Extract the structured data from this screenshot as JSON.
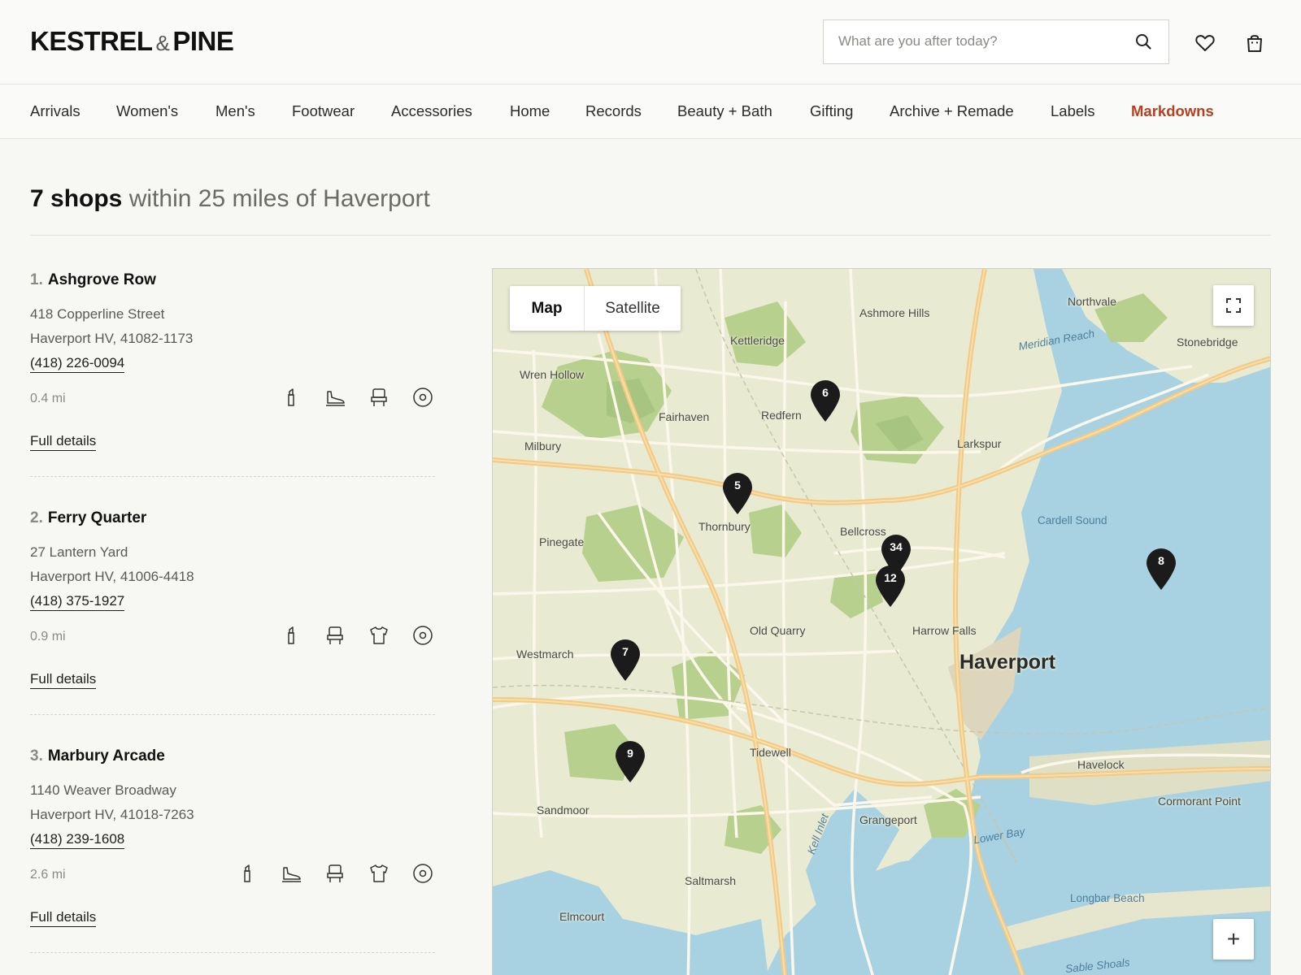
{
  "brand": {
    "name_left": "KESTREL",
    "amp": "&",
    "name_right": "PINE"
  },
  "search": {
    "placeholder": "What are you after today?"
  },
  "header_icons": [
    "search-icon",
    "heart-icon",
    "bag-icon"
  ],
  "nav": {
    "items": [
      "Arrivals",
      "Women's",
      "Men's",
      "Footwear",
      "Accessories",
      "Home",
      "Records",
      "Beauty + Bath",
      "Gifting",
      "Archive + Remade",
      "Labels"
    ],
    "sale": "Markdowns",
    "sale_color": "#b8401f"
  },
  "results": {
    "count": "7 shops",
    "rest": "within 25 miles of Haverport"
  },
  "shops": [
    {
      "num": "1.",
      "name": "Ashgrove Row",
      "street": "418 Copperline Street",
      "city": "Haverport HV, 41082-1173",
      "phone": "(418) 226-0094",
      "distance": "0.4 mi",
      "icons": [
        "lipstick-icon",
        "shoe-icon",
        "chair-icon",
        "record-icon"
      ],
      "details": "Full details"
    },
    {
      "num": "2.",
      "name": "Ferry Quarter",
      "street": "27 Lantern Yard",
      "city": "Haverport HV, 41006-4418",
      "phone": "(418) 375-1927",
      "distance": "0.9 mi",
      "icons": [
        "lipstick-icon",
        "chair-icon",
        "shirt-icon",
        "record-icon"
      ],
      "details": "Full details"
    },
    {
      "num": "3.",
      "name": "Marbury Arcade",
      "street": "1140 Weaver Broadway",
      "city": "Haverport HV, 41018-7263",
      "phone": "(418) 239-1608",
      "distance": "2.6 mi",
      "icons": [
        "lipstick-icon",
        "shoe-icon",
        "chair-icon",
        "shirt-icon",
        "record-icon"
      ],
      "details": "Full details"
    }
  ],
  "map": {
    "mode_map": "Map",
    "mode_satellite": "Satellite",
    "active_mode": "Map",
    "zoom_in": "+",
    "colors": {
      "water": "#a8d2e2",
      "land": "#e8ead2",
      "park": "#b8d08e",
      "road_major": "#f2c987",
      "road_minor": "#fbf7ea"
    },
    "places": [
      "Ashmore Hills",
      "Northvale",
      "Stonebridge",
      "Kettleridge",
      "Wren Hollow",
      "Redfern",
      "Fairhaven",
      "Milbury",
      "Larkspur",
      "Thornbury",
      "Pinegate",
      "Bellcross",
      "Cardell Sound",
      "Harrow Falls",
      "Old Quarry",
      "Westmarch",
      "Haverport",
      "Tidewell",
      "Havelock",
      "Sandmoor",
      "Grangeport",
      "Cormorant Point",
      "Saltmarsh",
      "Longbar Beach",
      "Elmcourt",
      "Sable Shoals"
    ],
    "water_labels": [
      "Meridian Reach",
      "Kell Inlet",
      "Lower Bay"
    ],
    "pins": [
      "6",
      "5",
      "34",
      "12",
      "8",
      "7",
      "9"
    ]
  }
}
